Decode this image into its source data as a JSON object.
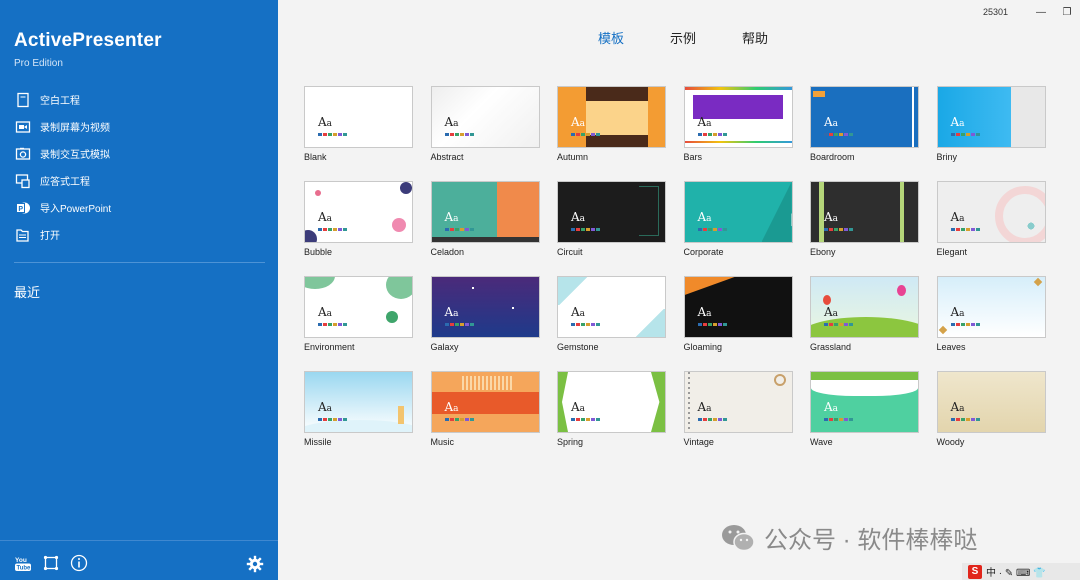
{
  "app": {
    "title": "ActivePresenter",
    "edition": "Pro Edition"
  },
  "titlebar": {
    "number": "25301",
    "minimize": "—",
    "restore": "❐"
  },
  "menu": [
    {
      "label": "空白工程",
      "icon": "blank-project-icon"
    },
    {
      "label": "录制屏幕为视频",
      "icon": "record-video-icon"
    },
    {
      "label": "录制交互式模拟",
      "icon": "camera-icon"
    },
    {
      "label": "应答式工程",
      "icon": "responsive-project-icon"
    },
    {
      "label": "导入PowerPoint",
      "icon": "powerpoint-icon"
    },
    {
      "label": "打开",
      "icon": "open-folder-icon"
    }
  ],
  "recent": "最近",
  "tabs": [
    {
      "label": "模板",
      "active": true
    },
    {
      "label": "示例",
      "active": false
    },
    {
      "label": "帮助",
      "active": false
    }
  ],
  "templates": [
    "Blank",
    "Abstract",
    "Autumn",
    "Bars",
    "Boardroom",
    "Briny",
    "Bubble",
    "Celadon",
    "Circuit",
    "Corporate",
    "Ebony",
    "Elegant",
    "Environment",
    "Galaxy",
    "Gemstone",
    "Gloaming",
    "Grassland",
    "Leaves",
    "Missile",
    "Music",
    "Spring",
    "Vintage",
    "Wave",
    "Woody"
  ],
  "thumb_text": {
    "big": "A",
    "small": "a"
  },
  "watermark": "公众号 · 软件棒棒哒",
  "tray": {
    "logo": "S",
    "text": "中 · ✎ ⌨ 👕"
  },
  "colors": {
    "sidebar": "#1570c4",
    "accent": "#1570c4"
  }
}
